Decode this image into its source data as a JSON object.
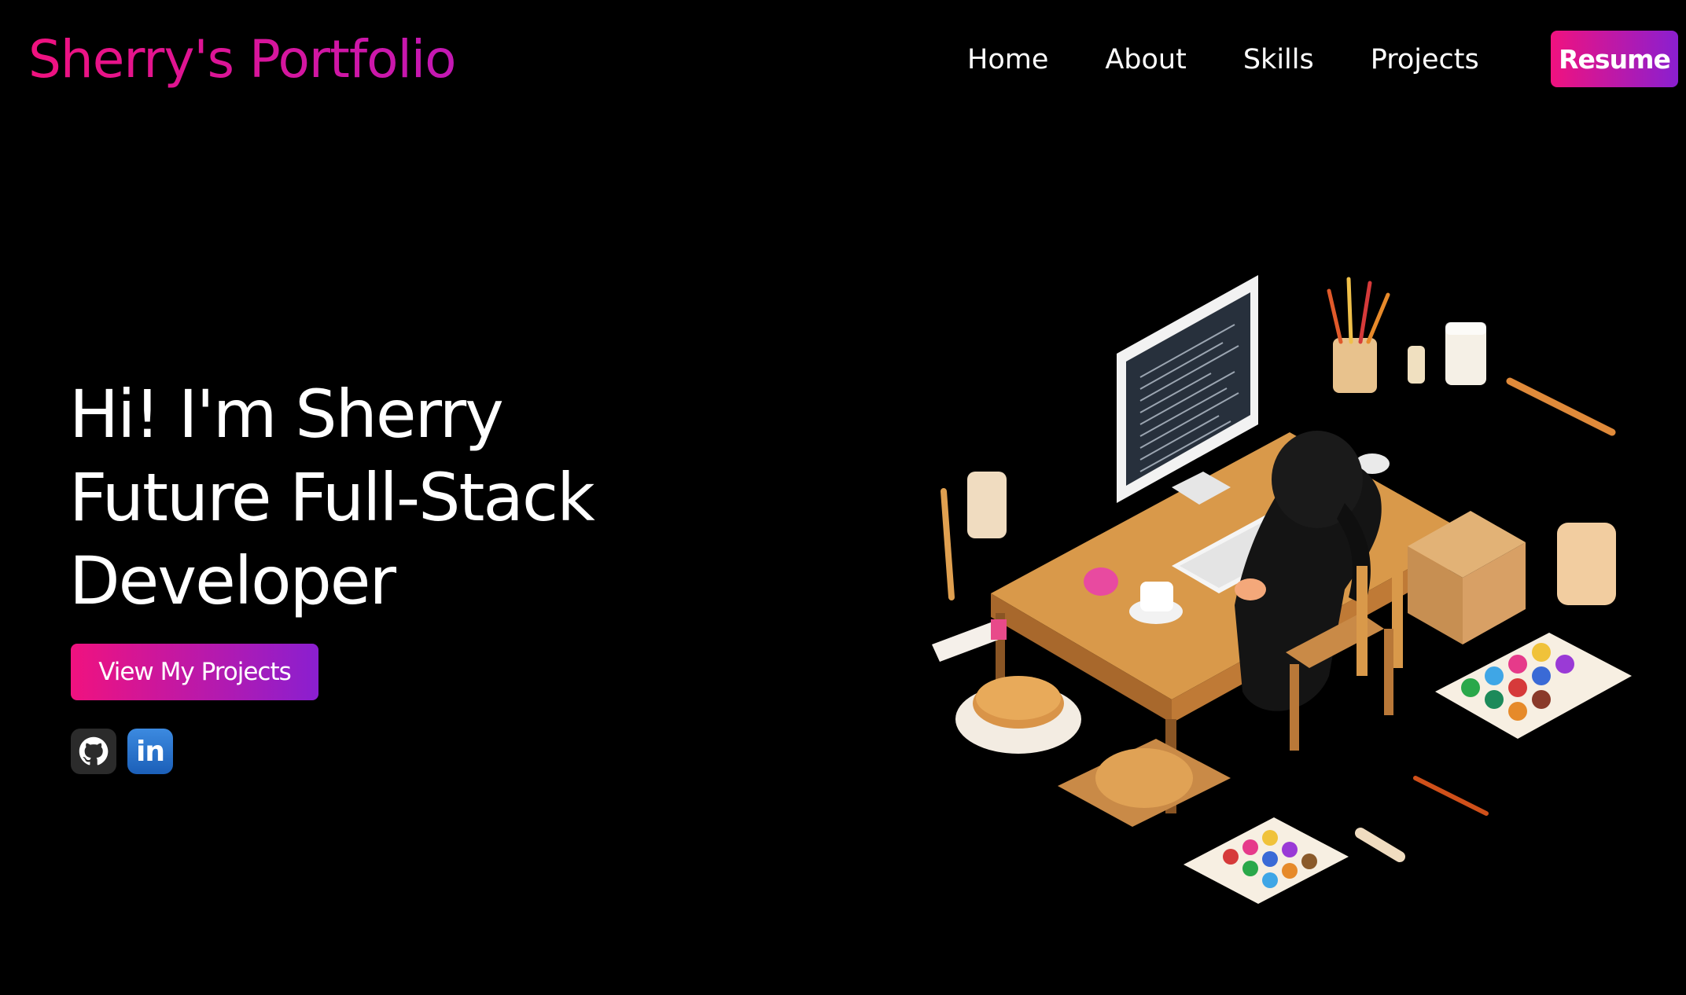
{
  "header": {
    "brand": "Sherry's Portfolio",
    "nav": [
      "Home",
      "About",
      "Skills",
      "Projects"
    ],
    "resume_label": "Resume"
  },
  "hero": {
    "lines": [
      "Hi! I'm Sherry",
      "Future Full-Stack",
      "Developer"
    ],
    "cta_label": "View My Projects"
  },
  "social": {
    "icons": [
      "github-icon",
      "linkedin-icon"
    ],
    "linkedin_text": "in"
  },
  "illustration": {
    "icon": "developer-desk-illustration"
  },
  "colors": {
    "background": "#000000",
    "accent_pink": "#f0127f",
    "accent_purple": "#8a1fd0",
    "text": "#ffffff"
  }
}
